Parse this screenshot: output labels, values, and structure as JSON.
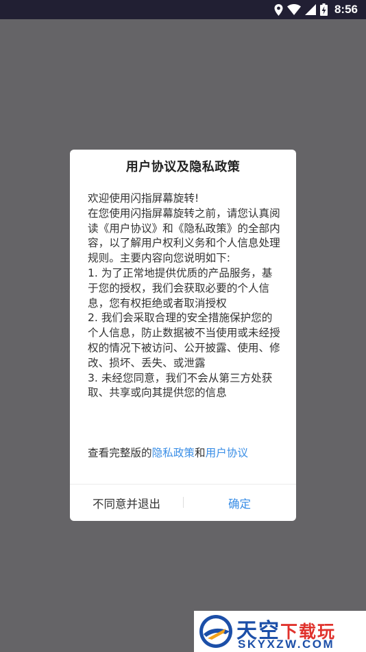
{
  "status_bar": {
    "time": "8:56",
    "icons": [
      "location-icon",
      "wifi-icon",
      "signal-icon",
      "battery-charging-icon"
    ]
  },
  "dialog": {
    "title": "用户协议及隐私政策",
    "body": "欢迎使用闪指屏幕旋转!\n在您使用闪指屏幕旋转之前，请您认真阅读《用户协议》和《隐私政策》的全部内容，以了解用户权利义务和个人信息处理规则。主要内容向您说明如下:\n1. 为了正常地提供优质的产品服务，基于您的授权，我们会获取必要的个人信息，您有权拒绝或者取消授权\n2. 我们会采取合理的安全措施保护您的个人信息，防止数据被不当使用或未经授权的情况下被访问、公开披露、使用、修改、损坏、丢失、或泄露\n3. 未经您同意，我们不会从第三方处获取、共享或向其提供您的信息",
    "link_prefix": "查看完整版的",
    "privacy_link": "隐私政策",
    "link_and": "和",
    "agreement_link": "用户协议",
    "cancel_label": "不同意并退出",
    "ok_label": "确定"
  },
  "colors": {
    "overlay": "#656467",
    "status_bar": "#211f33",
    "link": "#3a8ee6"
  },
  "watermark": {
    "brand_blue": "天空",
    "brand_red": "下载玩",
    "domain": "SKYXZW.COM"
  }
}
